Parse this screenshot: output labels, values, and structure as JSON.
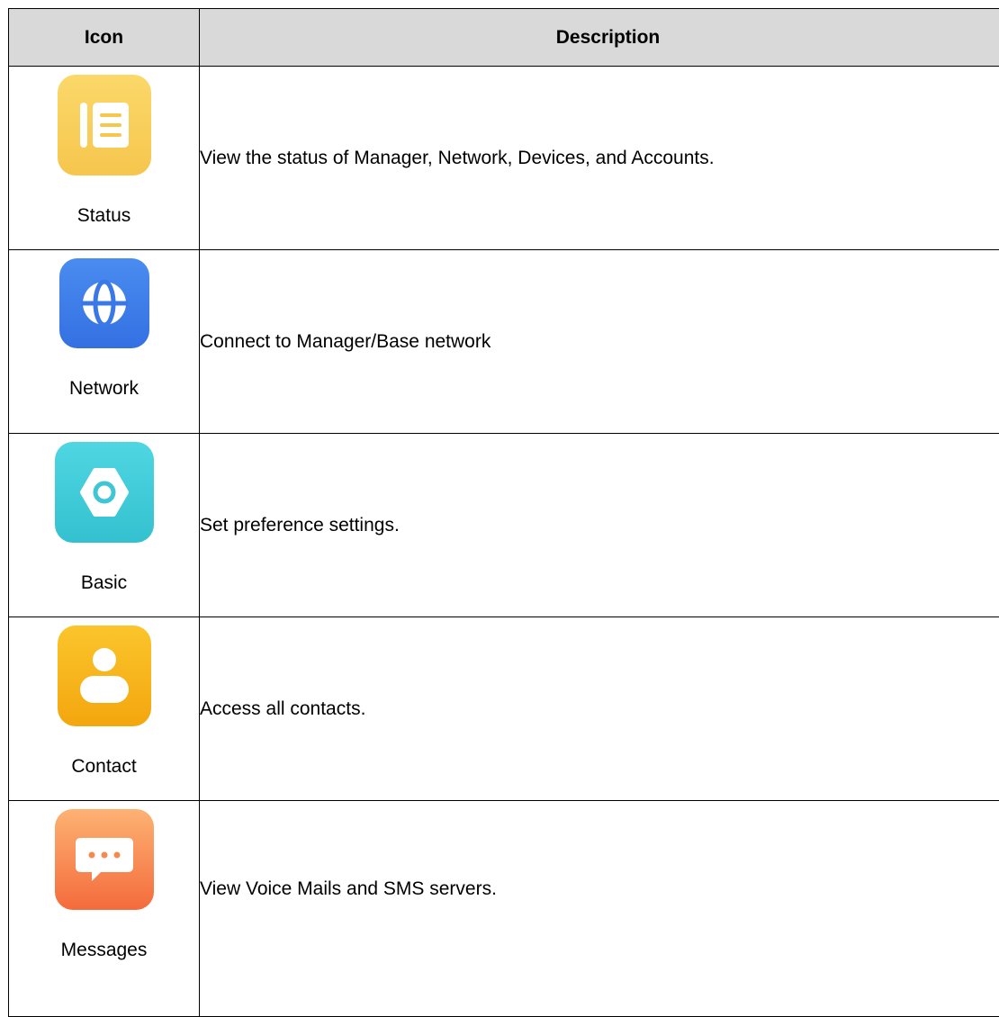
{
  "table": {
    "headers": {
      "icon": "Icon",
      "description": "Description"
    },
    "rows": [
      {
        "label": "Status",
        "description": "View the status of Manager, Network, Devices, and Accounts.",
        "icon": "list-document-icon",
        "color": "#F8CC5A"
      },
      {
        "label": "Network",
        "description": "Connect to Manager/Base network",
        "icon": "globe-icon",
        "color": "#3F7FEA"
      },
      {
        "label": "Basic",
        "description": "Set preference settings.",
        "icon": "gear-icon",
        "color": "#3ECCD9"
      },
      {
        "label": "Contact",
        "description": "Access all contacts.",
        "icon": "person-icon",
        "color": "#F9B71E"
      },
      {
        "label": "Messages",
        "description": "View Voice Mails and SMS servers.",
        "icon": "message-bubble-icon",
        "color": "#F77E45"
      }
    ]
  }
}
